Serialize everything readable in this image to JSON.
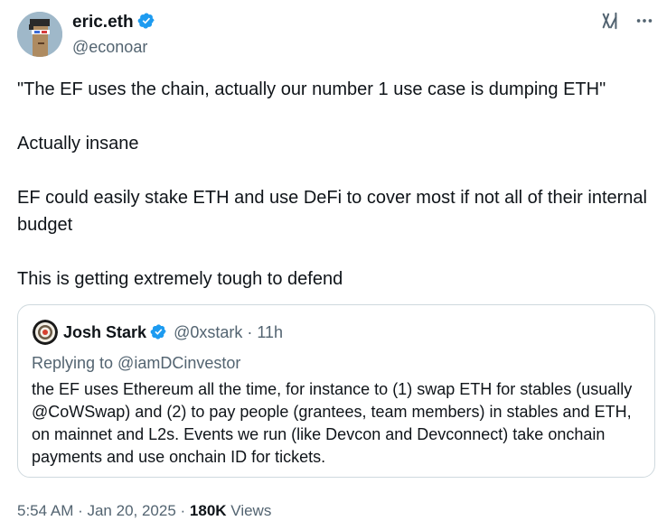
{
  "author": {
    "name": "eric.eth",
    "handle": "@econoar",
    "verified": true
  },
  "tweet": {
    "paragraphs": [
      "\"The EF uses the chain, actually our number 1 use case is dumping ETH\"",
      "Actually insane",
      "EF could easily stake ETH and use DeFi to cover most if not all of their internal budget",
      "This is getting extremely tough to defend"
    ]
  },
  "quote": {
    "name": "Josh Stark",
    "handle_time": "@0xstark · 11h",
    "replying": "Replying to @iamDCinvestor",
    "text": "the EF uses Ethereum all the time, for instance to (1) swap ETH for stables (usually @CoWSwap) and (2) to pay people (grantees, team members) in stables and ETH, on mainnet and L2s. Events we run (like Devcon and Devconnect) take onchain payments and use onchain ID for tickets."
  },
  "meta": {
    "timestamp": "5:54 AM · Jan 20, 2025",
    "separator": " · ",
    "views_count": "180K",
    "views_label": "Views"
  },
  "icons": {
    "verified": "verified-badge-icon",
    "grok": "grok-icon",
    "more": "more-options-icon"
  },
  "colors": {
    "verified": "#1d9bf0",
    "secondary_text": "#536471",
    "border": "#cfd9de"
  }
}
